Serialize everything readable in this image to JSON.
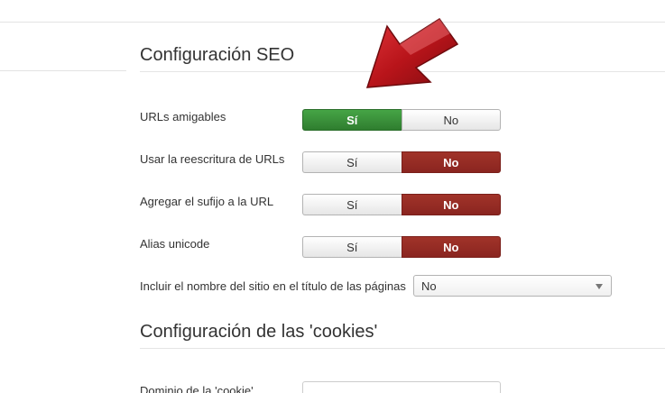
{
  "seo_section": {
    "title": "Configuración SEO",
    "fields": [
      {
        "label": "URLs amigables",
        "yes": "Sí",
        "no": "No",
        "selected": "yes"
      },
      {
        "label": "Usar la reescritura de URLs",
        "yes": "Sí",
        "no": "No",
        "selected": "no"
      },
      {
        "label": "Agregar el sufijo a la URL",
        "yes": "Sí",
        "no": "No",
        "selected": "no"
      },
      {
        "label": "Alias unicode",
        "yes": "Sí",
        "no": "No",
        "selected": "no"
      }
    ],
    "site_name_field": {
      "label": "Incluir el nombre del sitio en el título de las páginas",
      "value": "No"
    }
  },
  "cookies_section": {
    "title": "Configuración de las 'cookies'",
    "domain_label": "Dominio de la 'cookie'"
  },
  "colors": {
    "yes_active": "#3a8a36",
    "no_active": "#8e2a22",
    "arrow": "#c0141a"
  },
  "icons": {
    "pointer": "red-arrow-icon",
    "dropdown": "caret-down-icon"
  }
}
